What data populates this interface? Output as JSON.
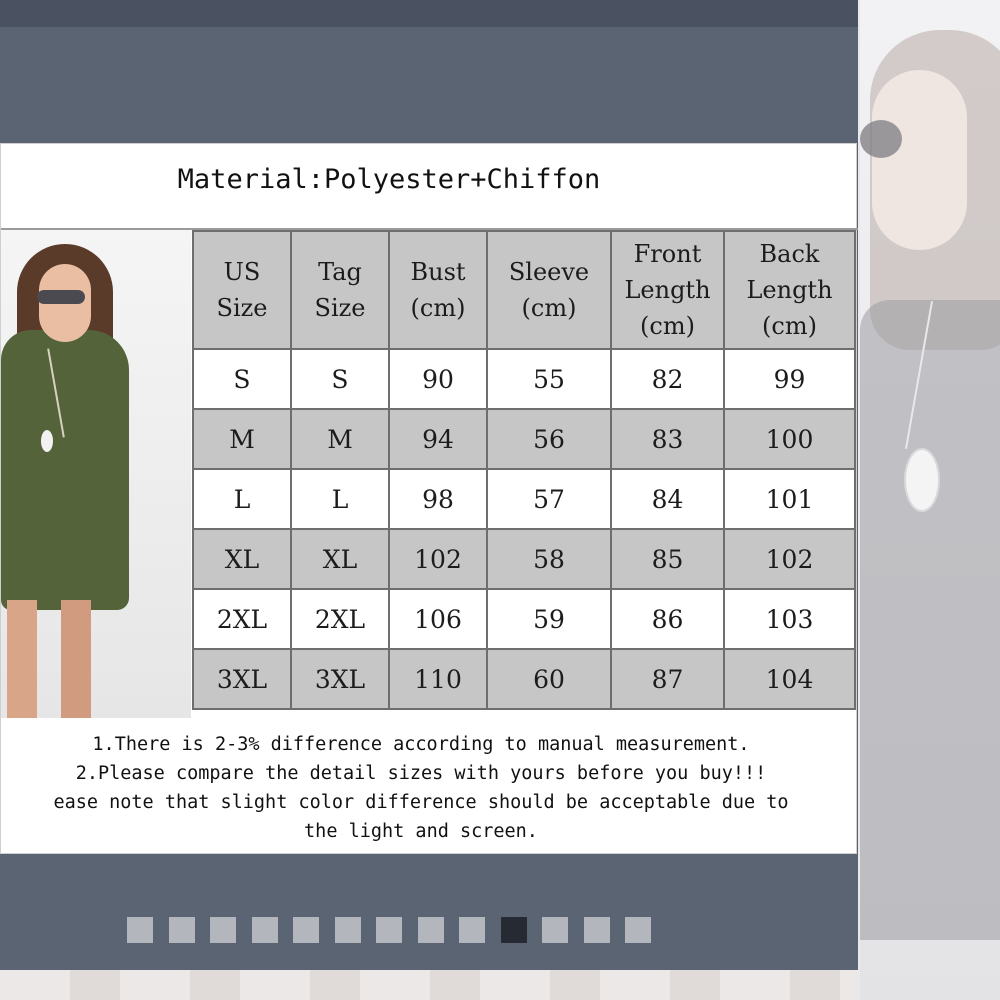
{
  "chart": {
    "title": "Material:Polyester+Chiffon",
    "columns": [
      "US Size",
      "Tag Size",
      "Bust (cm)",
      "Sleeve (cm)",
      "Front Length (cm)",
      "Back Length (cm)"
    ],
    "headers": [
      [
        "US",
        "Size"
      ],
      [
        "Tag",
        "Size"
      ],
      [
        "Bust",
        "(cm)"
      ],
      [
        "Sleeve",
        "(cm)"
      ],
      [
        "Front",
        "Length",
        "(cm)"
      ],
      [
        "Back",
        "Length",
        "(cm)"
      ]
    ],
    "rows": [
      [
        "S",
        "S",
        "90",
        "55",
        "82",
        "99"
      ],
      [
        "M",
        "M",
        "94",
        "56",
        "83",
        "100"
      ],
      [
        "L",
        "L",
        "98",
        "57",
        "84",
        "101"
      ],
      [
        "XL",
        "XL",
        "102",
        "58",
        "85",
        "102"
      ],
      [
        "2XL",
        "2XL",
        "106",
        "59",
        "86",
        "103"
      ],
      [
        "3XL",
        "3XL",
        "110",
        "60",
        "87",
        "104"
      ]
    ],
    "notes": [
      "1.There is 2-3% difference according to manual measurement.",
      "2.Please compare the detail sizes with yours before you buy!!!",
      "ease note that slight color difference should be acceptable due to",
      "the light and screen."
    ]
  },
  "pagination": {
    "count": 13,
    "active_index": 9
  },
  "colors": {
    "viewer_bg": "#5b6472",
    "header_fill": "#c6c6c6",
    "active_dot": "#262b33",
    "inactive_dot": "#b3b7bd"
  }
}
